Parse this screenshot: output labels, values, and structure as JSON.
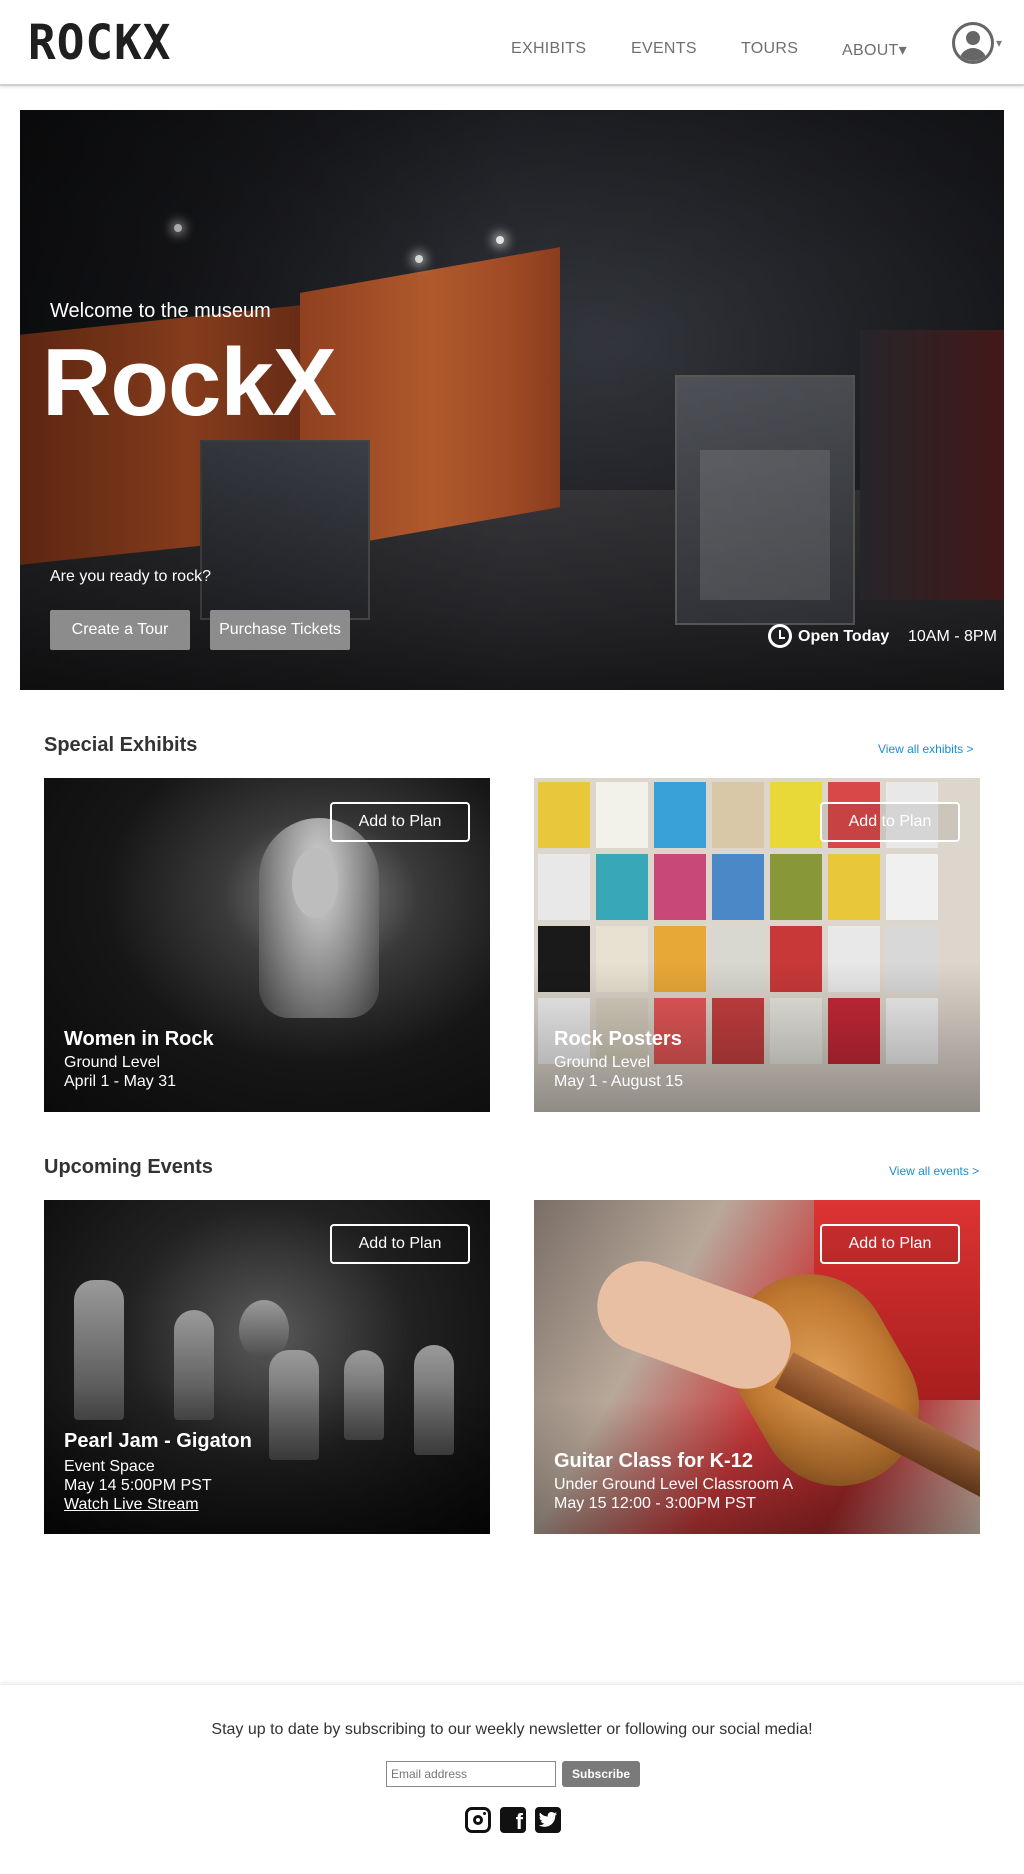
{
  "header": {
    "logo": "ROCKX",
    "nav": {
      "exhibits": "EXHIBITS",
      "events": "EVENTS",
      "tours": "TOURS",
      "about": "ABOUT▾"
    },
    "account_caret": "▾"
  },
  "hero": {
    "welcome": "Welcome to the museum",
    "title": "RockX",
    "question": "Are you ready to rock?",
    "create_tour": "Create a Tour",
    "purchase_tickets": "Purchase Tickets",
    "open_label": "Open Today",
    "hours": "10AM - 8PM"
  },
  "exhibits": {
    "title": "Special Exhibits",
    "view_all": "View all exhibits >",
    "cards": [
      {
        "button": "Add to Plan",
        "title": "Women in Rock",
        "location": "Ground Level",
        "dates": "April 1 - May 31"
      },
      {
        "button": "Add to Plan",
        "title": "Rock Posters",
        "location": "Ground Level",
        "dates": "May 1 - August 15"
      }
    ]
  },
  "events": {
    "title": "Upcoming Events",
    "view_all": "View all events >",
    "cards": [
      {
        "button": "Add to Plan",
        "title": "Pearl Jam - Gigaton",
        "location": "Event Space",
        "dates": "May 14 5:00PM PST",
        "link": "Watch Live Stream"
      },
      {
        "button": "Add to Plan",
        "title": "Guitar Class for K-12",
        "location": "Under Ground Level Classroom A",
        "dates": "May 15 12:00 - 3:00PM PST"
      }
    ]
  },
  "footer": {
    "text": "Stay up to date by subscribing to our weekly newsletter or following our social media!",
    "email_placeholder": "Email address",
    "subscribe": "Subscribe"
  }
}
